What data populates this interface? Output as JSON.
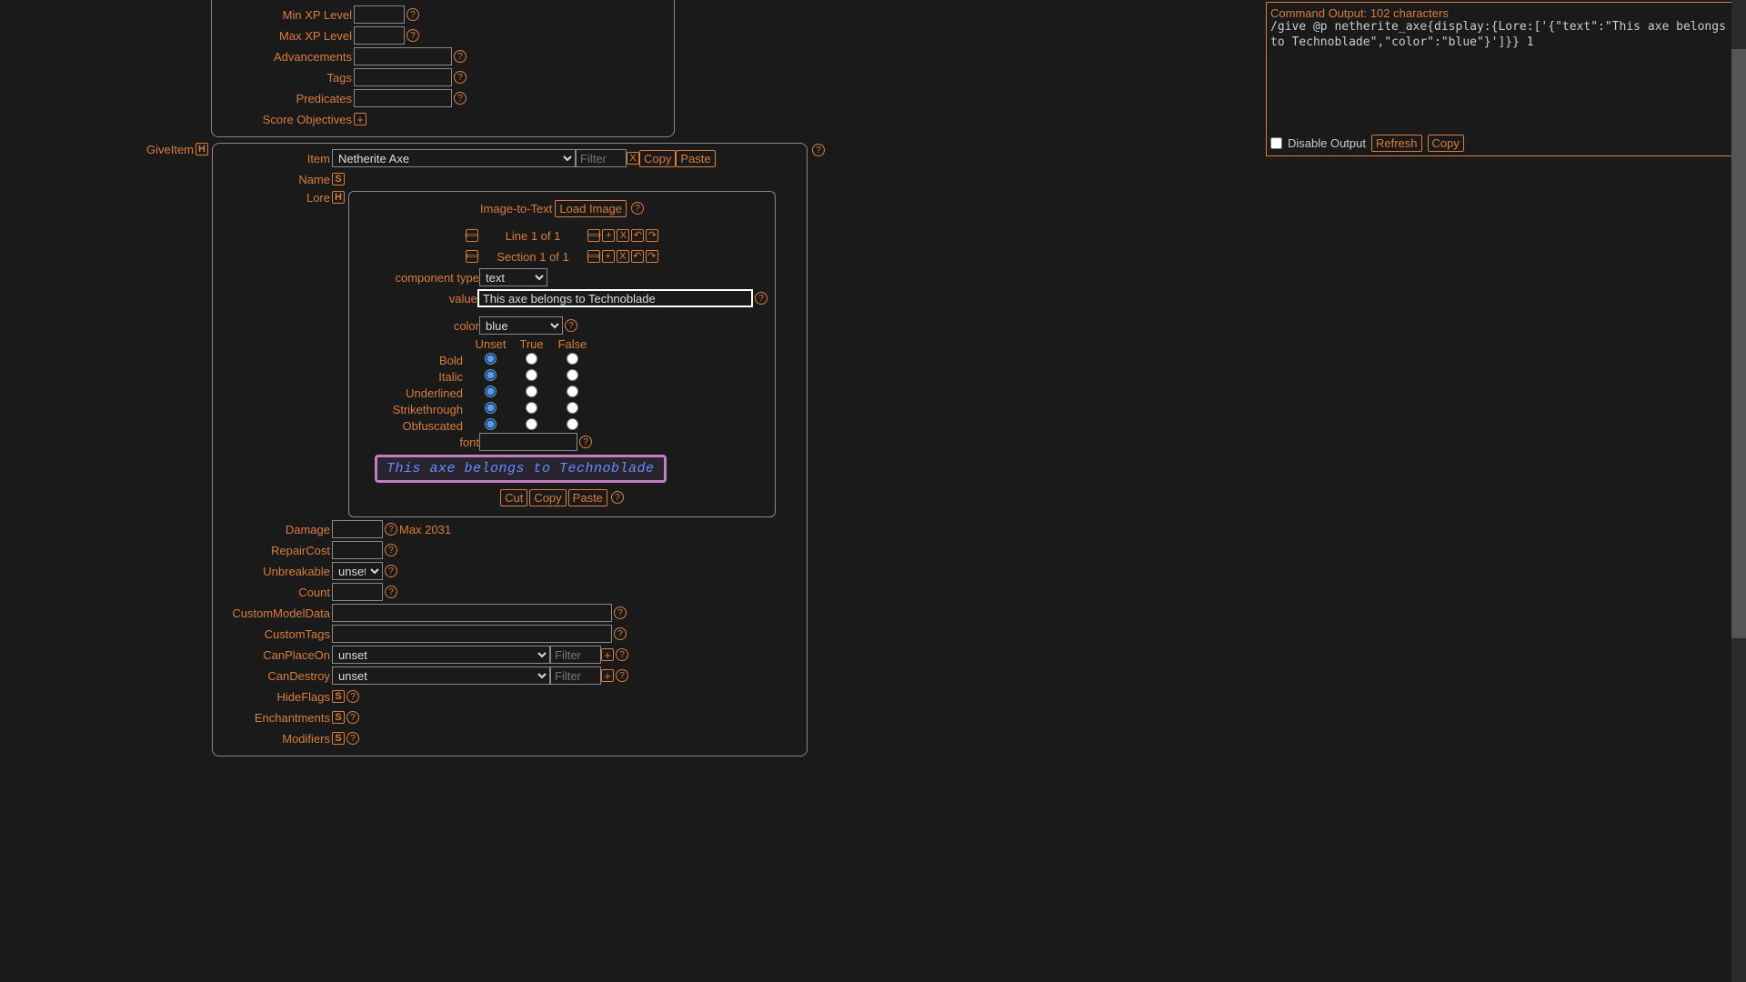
{
  "output": {
    "header": "Command Output: 102 characters",
    "command": "/give @p netherite_axe{display:{Lore:['{\"text\":\"This axe belongs to Technoblade\",\"color\":\"blue\"}']}} 1",
    "disable": "Disable Output",
    "refresh": "Refresh",
    "copy": "Copy"
  },
  "top_fields": {
    "min_xp": "Min XP Level",
    "max_xp": "Max XP Level",
    "advancements": "Advancements",
    "tags": "Tags",
    "predicates": "Predicates",
    "score_obj": "Score Objectives"
  },
  "give": {
    "label": "GiveItem",
    "item_label": "Item",
    "item_value": "Netherite Axe",
    "filter_ph": "Filter",
    "x": "X",
    "copy": "Copy",
    "paste": "Paste",
    "name": "Name",
    "lore": "Lore"
  },
  "lore": {
    "img_to_text": "Image-to-Text",
    "load_image": "Load Image",
    "line_info": "Line 1 of 1",
    "section_info": "Section 1 of 1",
    "comp_type_label": "component type",
    "comp_type_value": "text",
    "value_label": "value",
    "value_text": "This axe belongs to Technoblade",
    "color_label": "color",
    "color_value": "blue",
    "hdr_unset": "Unset",
    "hdr_true": "True",
    "hdr_false": "False",
    "bold": "Bold",
    "italic": "Italic",
    "underlined": "Underlined",
    "strikethrough": "Strikethrough",
    "obfuscated": "Obfuscated",
    "font": "font",
    "preview": "This axe belongs to Technoblade",
    "cut": "Cut",
    "copy": "Copy",
    "paste": "Paste"
  },
  "item_fields": {
    "damage": "Damage",
    "damage_max": "Max 2031",
    "repair": "RepairCost",
    "unbreak": "Unbreakable",
    "unbreak_val": "unset",
    "count": "Count",
    "cmd": "CustomModelData",
    "custom_tags": "CustomTags",
    "can_place": "CanPlaceOn",
    "can_destroy": "CanDestroy",
    "unset": "unset",
    "filter": "Filter",
    "hideflags": "HideFlags",
    "enchantments": "Enchantments",
    "modifiers": "Modifiers"
  },
  "icons": {
    "help": "?",
    "plus": "+",
    "s": "S",
    "h": "H",
    "x": "X",
    "prev": "⟸",
    "next": "⟹",
    "undo": "↶",
    "redo": "↷"
  }
}
